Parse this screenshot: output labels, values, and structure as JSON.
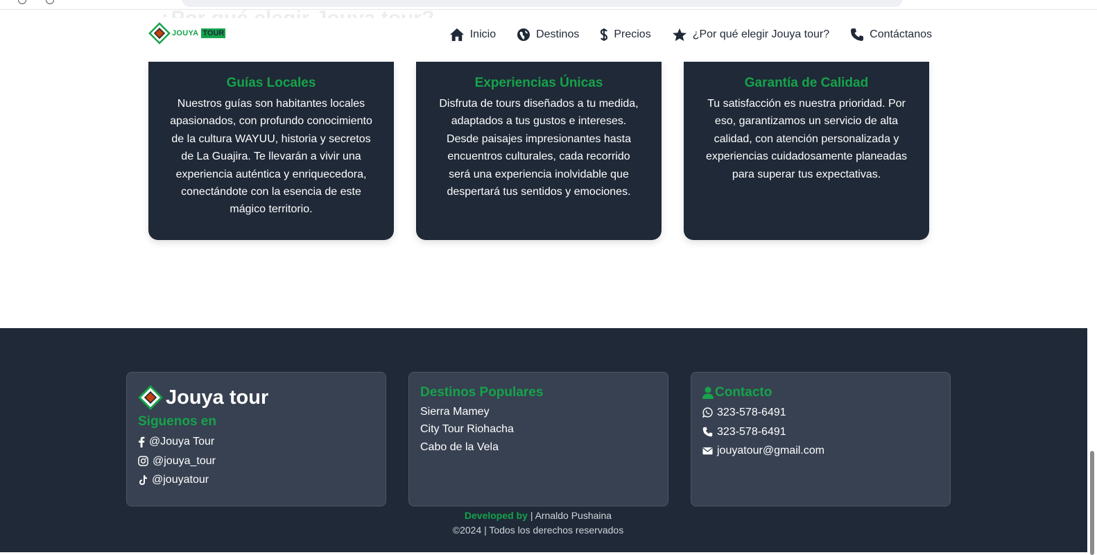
{
  "colors": {
    "accent": "#16a34a",
    "dark": "#1f2937",
    "panel": "#374151"
  },
  "navbar": {
    "logo_text": "JOUYA",
    "logo_badge": "TOUR",
    "links": [
      {
        "label": "Inicio",
        "icon": "home-icon"
      },
      {
        "label": "Destinos",
        "icon": "globe-icon"
      },
      {
        "label": "Precios",
        "icon": "dollar-icon"
      },
      {
        "label": "¿Por qué elegir Jouya tour?",
        "icon": "star-icon"
      },
      {
        "label": "Contáctanos",
        "icon": "phone-icon"
      }
    ]
  },
  "section": {
    "title": "¿Por qué elegir Jouya tour?",
    "cards": [
      {
        "title": "Guías Locales",
        "text": "Nuestros guías son habitantes locales apasionados, con profundo conocimiento de la cultura WAYUU, historia y secretos de La Guajira. Te llevarán a vivir una experiencia auténtica y enriquecedora, conectándote con la esencia de este mágico territorio."
      },
      {
        "title": "Experiencias Únicas",
        "text": "Disfruta de tours diseñados a tu medida, adaptados a tus gustos e intereses. Desde paisajes impresionantes hasta encuentros culturales, cada recorrido será una experiencia inolvidable que despertará tus sentidos y emociones."
      },
      {
        "title": "Garantía de Calidad",
        "text": "Tu satisfacción es nuestra prioridad. Por eso, garantizamos un servicio de alta calidad, con atención personalizada y experiencias cuidadosamente planeadas para superar tus expectativas."
      }
    ]
  },
  "footer": {
    "brand": "Jouya tour",
    "social_heading": "Siguenos en",
    "social": [
      {
        "label": "@Jouya Tour",
        "icon": "facebook-icon"
      },
      {
        "label": "@jouya_tour",
        "icon": "instagram-icon"
      },
      {
        "label": "@jouyatour",
        "icon": "tiktok-icon"
      }
    ],
    "destinations_heading": "Destinos Populares",
    "destinations": [
      "Sierra Mamey",
      "City Tour Riohacha",
      "Cabo de la Vela"
    ],
    "contact_heading": "Contacto",
    "contact": [
      {
        "label": "323-578-6491",
        "icon": "whatsapp-icon"
      },
      {
        "label": "323-578-6491",
        "icon": "phone-icon"
      },
      {
        "label": "jouyatour@gmail.com",
        "icon": "envelope-icon"
      }
    ],
    "developed_by_label": "Developed by",
    "developer": "| Arnaldo Pushaina",
    "copyright": "©2024 | Todos los derechos reservados"
  }
}
